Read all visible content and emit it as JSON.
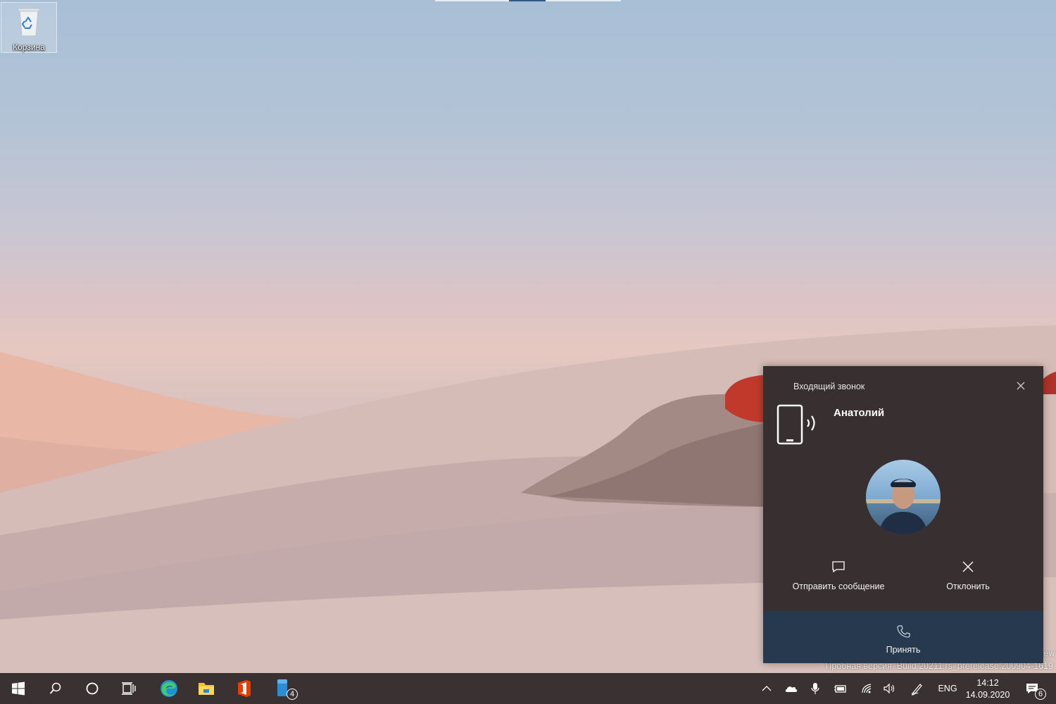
{
  "desktop": {
    "icons": [
      {
        "label": "Корзина",
        "icon": "recycle-bin-icon"
      }
    ],
    "watermark": "Пробная версия. Build 20211.rs_prerelease.200904-1619",
    "watermark_edge": "ew"
  },
  "toast": {
    "heading": "Входящий звонок",
    "caller_name": "Анатолий",
    "actions": {
      "message_label": "Отправить сообщение",
      "decline_label": "Отклонить",
      "accept_label": "Принять"
    },
    "colors": {
      "background": "#372f30",
      "accept_bar": "#26394f"
    }
  },
  "taskbar": {
    "pinned": [
      {
        "name": "start",
        "icon": "windows-logo-icon"
      },
      {
        "name": "search",
        "icon": "search-icon"
      },
      {
        "name": "cortana",
        "icon": "cortana-circle-icon"
      },
      {
        "name": "task-view",
        "icon": "task-view-icon"
      },
      {
        "name": "edge",
        "icon": "edge-browser-icon"
      },
      {
        "name": "file-explorer",
        "icon": "folder-icon"
      },
      {
        "name": "office",
        "icon": "office-icon"
      },
      {
        "name": "your-phone",
        "icon": "phone-app-icon",
        "badge": "4"
      }
    ],
    "tray": {
      "language": "ENG",
      "time": "14:12",
      "date": "14.09.2020",
      "notifications_badge": "6"
    },
    "color": "#3a3132"
  }
}
